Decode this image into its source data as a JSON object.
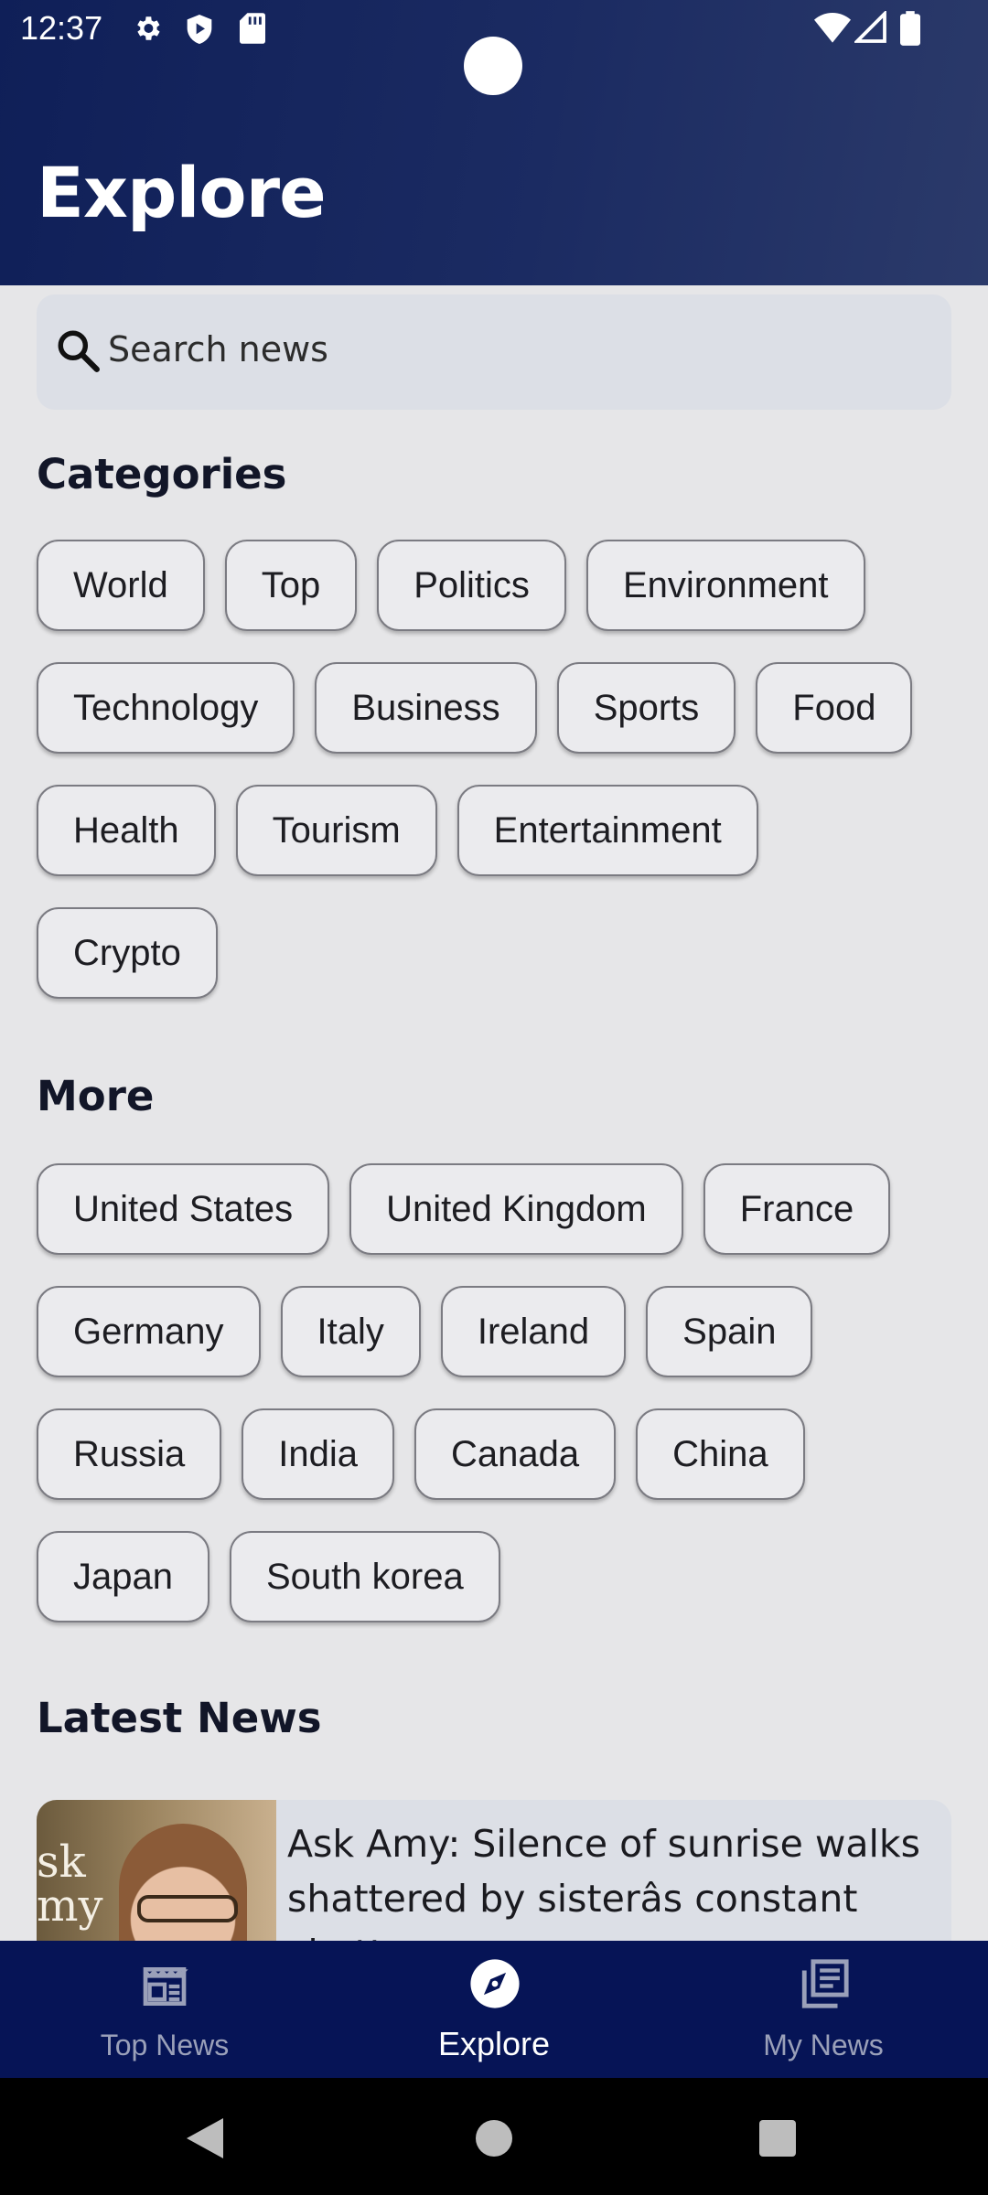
{
  "status": {
    "time": "12:37"
  },
  "header": {
    "title": "Explore"
  },
  "search": {
    "placeholder": "Search news"
  },
  "categories": {
    "heading": "Categories",
    "rows": [
      [
        "World",
        "Top",
        "Politics",
        "Environment"
      ],
      [
        "Technology",
        "Business",
        "Sports",
        "Food"
      ],
      [
        "Health",
        "Tourism",
        "Entertainment"
      ],
      [
        "Crypto"
      ]
    ]
  },
  "more": {
    "heading": "More",
    "rows": [
      [
        "United States",
        "United Kingdom",
        "France"
      ],
      [
        "Germany",
        "Italy",
        "Ireland",
        "Spain"
      ],
      [
        "Russia",
        "India",
        "Canada",
        "China"
      ],
      [
        "Japan",
        "South korea"
      ]
    ]
  },
  "latest": {
    "heading": "Latest News",
    "items": [
      {
        "title": "Ask Amy: Silence of sunrise walks shattered by sisterâs constant chatter",
        "thumb_text": "sk\nmy"
      }
    ]
  },
  "nav": {
    "items": [
      {
        "label": "Top News",
        "icon": "newspaper-icon",
        "active": false
      },
      {
        "label": "Explore",
        "icon": "compass-icon",
        "active": true
      },
      {
        "label": "My News",
        "icon": "library-icon",
        "active": false
      }
    ]
  },
  "colors": {
    "header": "#1b2b62",
    "nav": "#061456",
    "chip_bg": "#ebebee",
    "search_bg": "#dcdfe6"
  }
}
